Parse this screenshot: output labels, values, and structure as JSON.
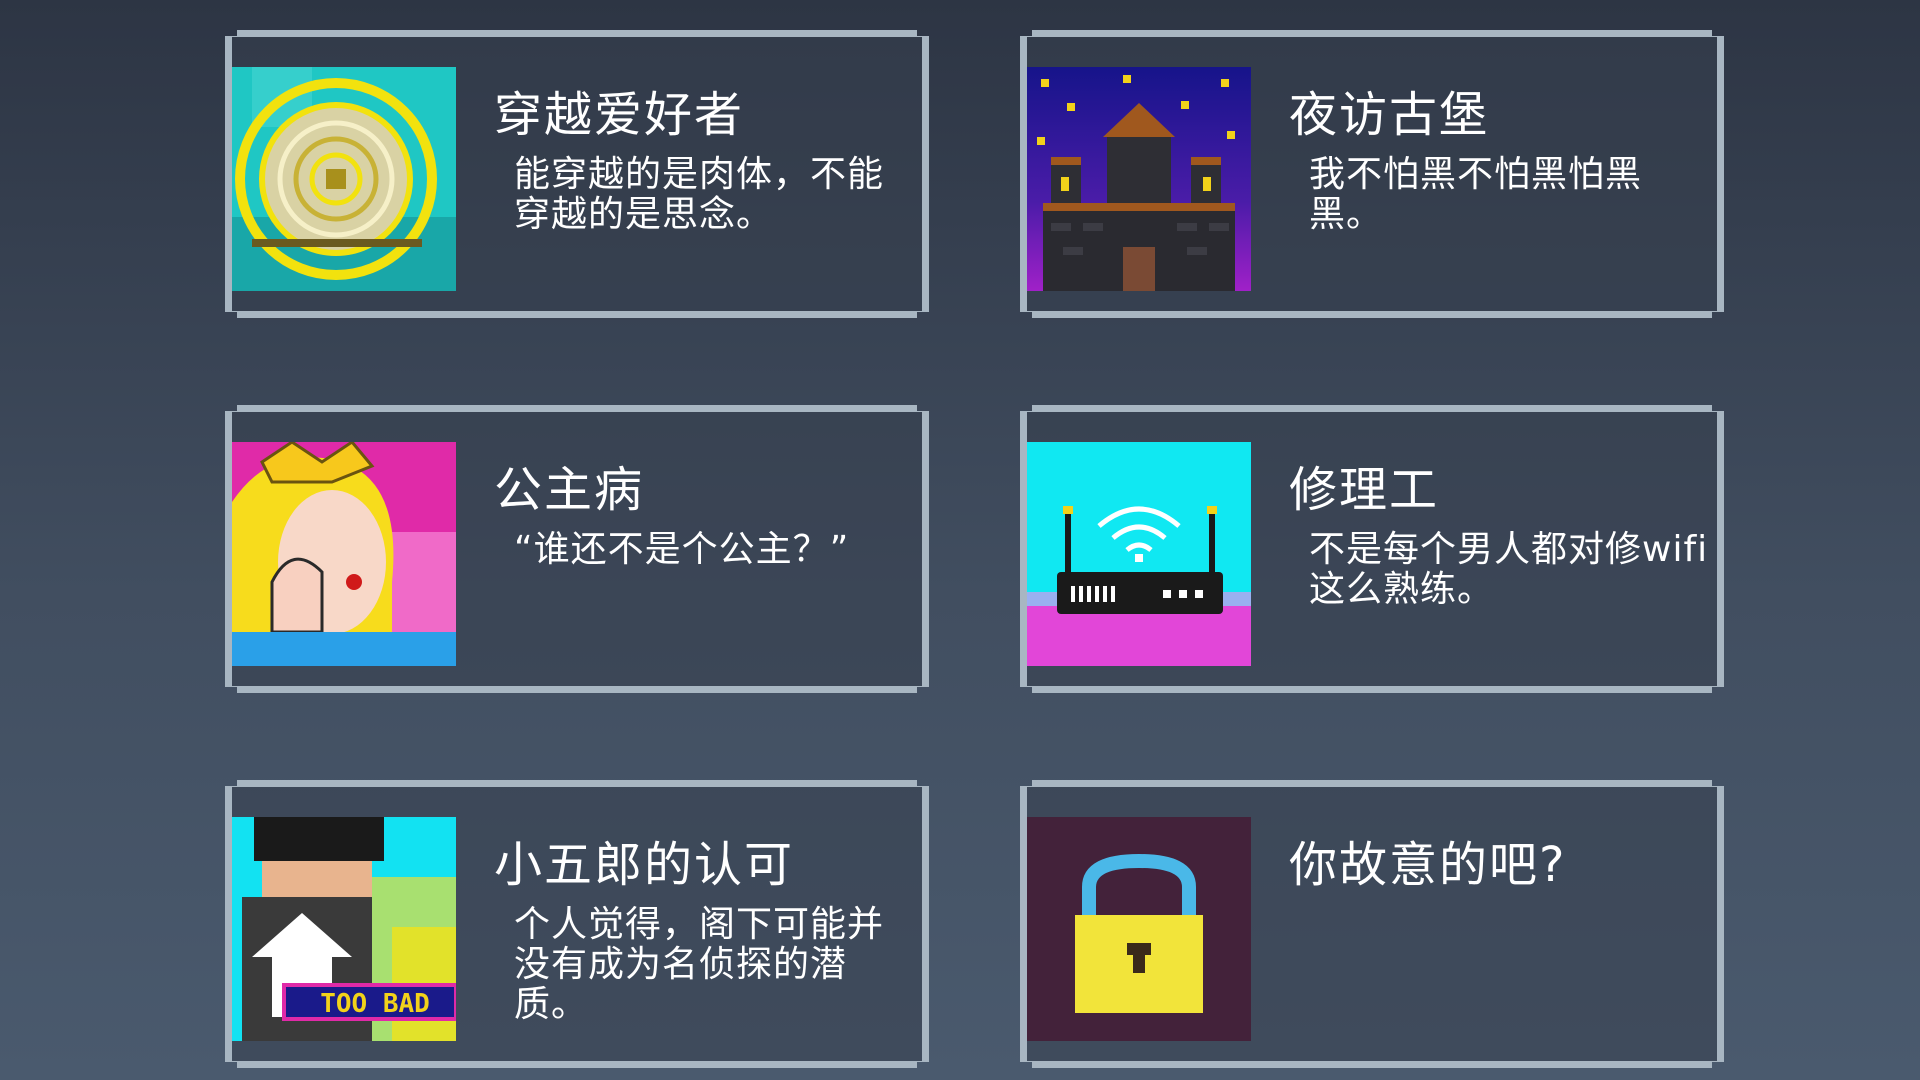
{
  "achievements": [
    {
      "title": "穿越爱好者",
      "desc": "能穿越的是肉体，不能穿越的是思念。",
      "icon": "portal-icon"
    },
    {
      "title": "夜访古堡",
      "desc": "我不怕黑不怕黑怕黑黑。",
      "icon": "castle-icon"
    },
    {
      "title": "公主病",
      "desc": "“谁还不是个公主？”",
      "icon": "princess-icon"
    },
    {
      "title": "修理工",
      "desc": "不是每个男人都对修wifi这么熟练。",
      "icon": "wifi-router-icon"
    },
    {
      "title": "小五郎的认可",
      "desc": "个人觉得，阁下可能并没有成为名侦探的潜质。",
      "icon": "detective-icon",
      "badge": "TOO BAD"
    },
    {
      "title": "你故意的吧?",
      "desc": "",
      "icon": "lock-icon"
    }
  ],
  "colors": {
    "card_border": "#a8b6c2",
    "background_top": "#2d3544",
    "background_bottom": "#4a5a6e"
  }
}
